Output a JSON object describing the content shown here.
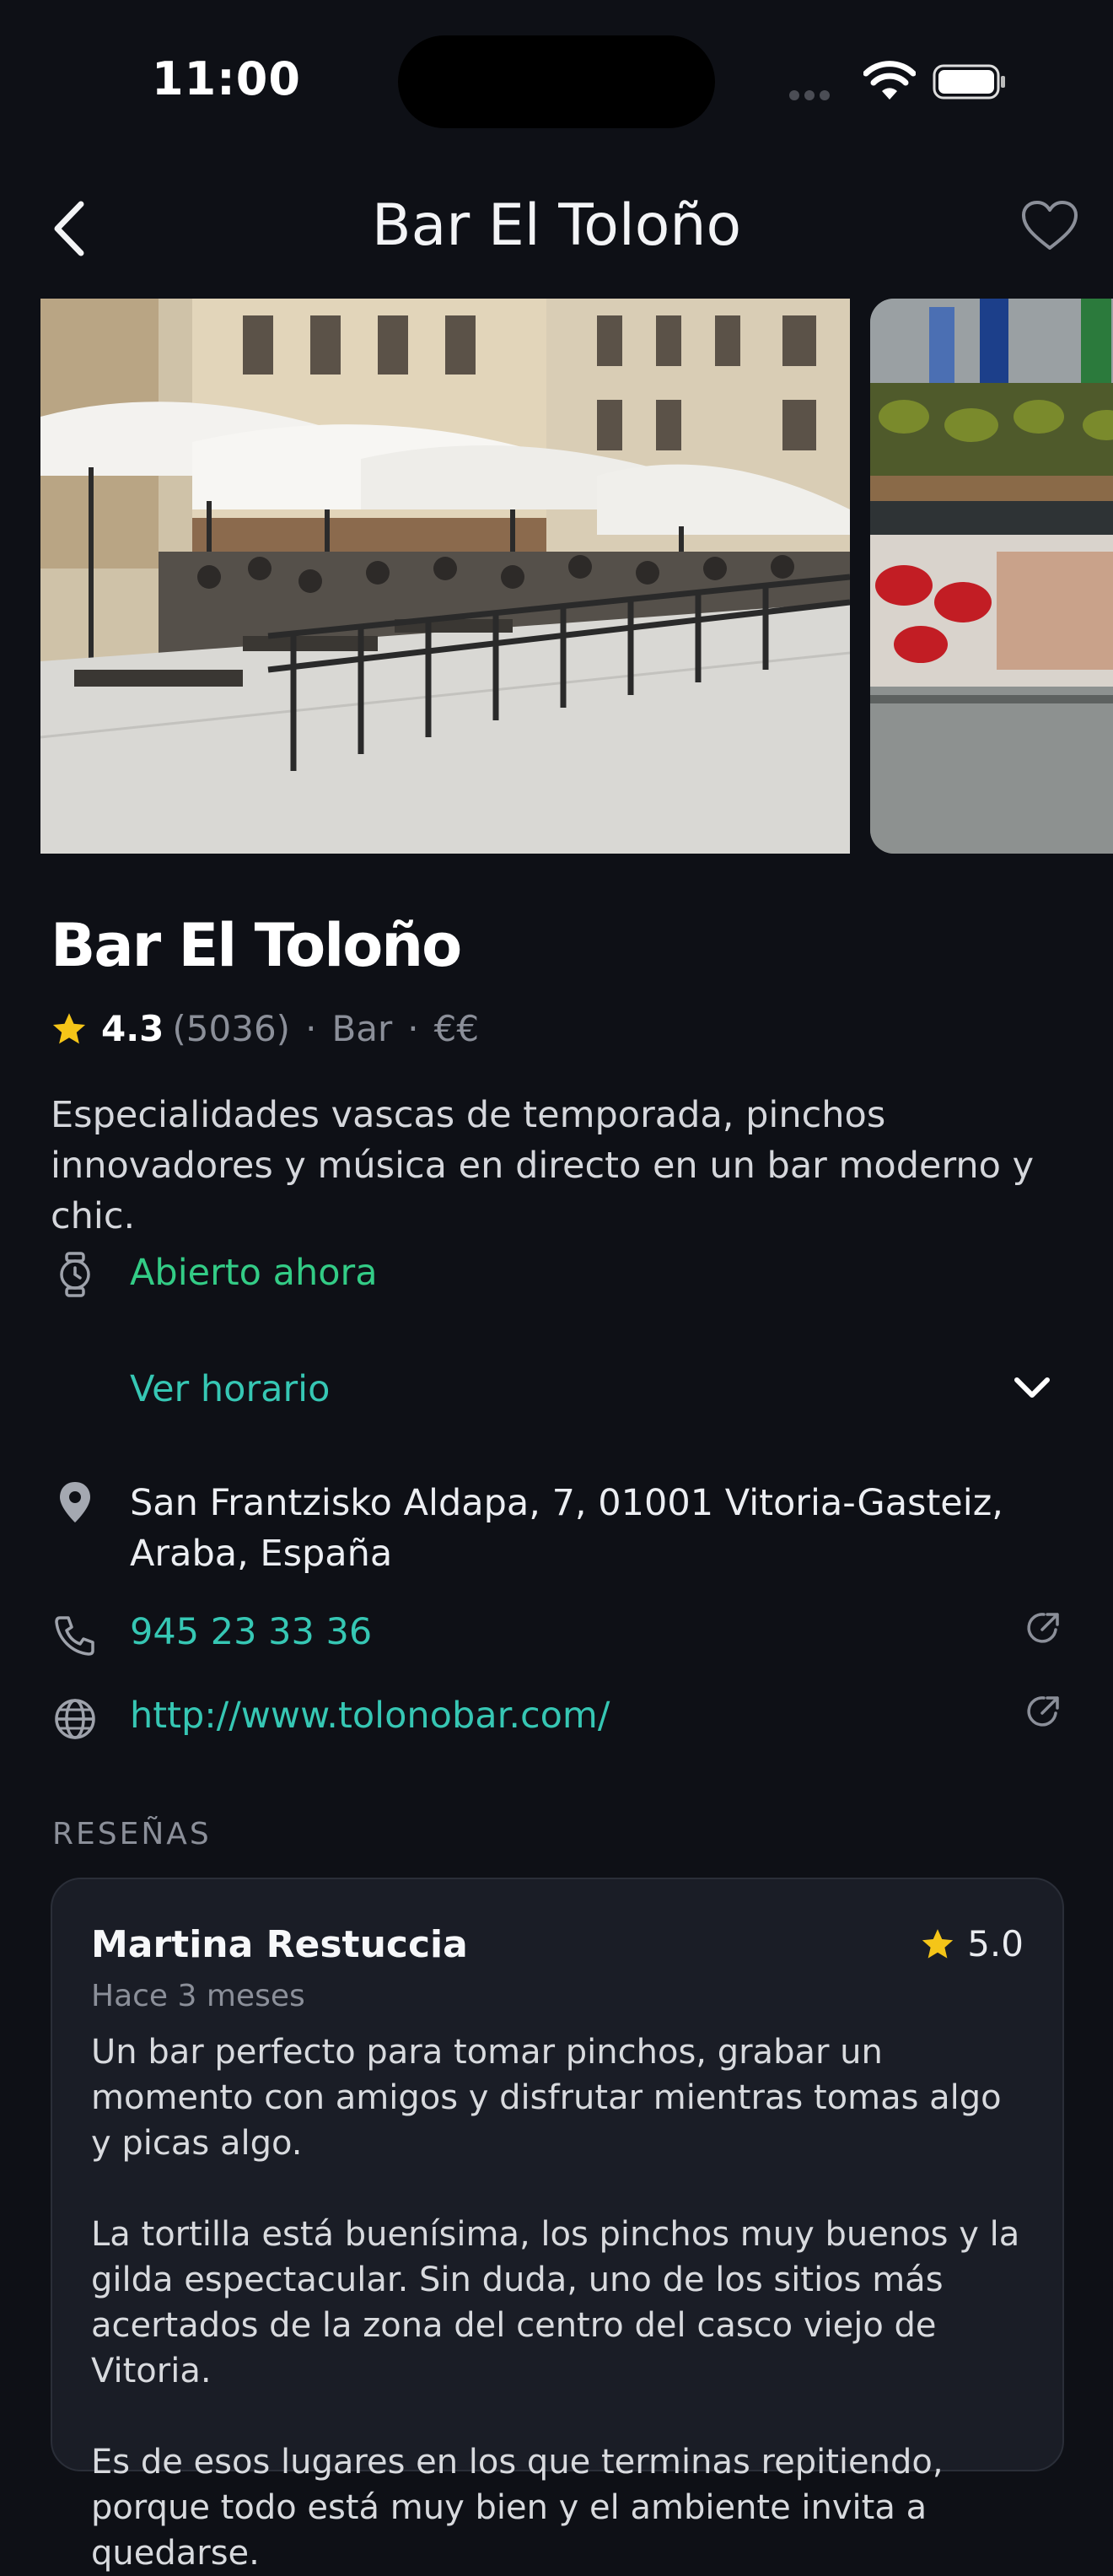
{
  "status_bar": {
    "time": "11:00"
  },
  "nav": {
    "title": "Bar El Toloño"
  },
  "place": {
    "name": "Bar El Toloño",
    "rating": "4.3",
    "reviews_count": "(5036)",
    "separator": "·",
    "category": "Bar",
    "price": "€€",
    "description": "Especialidades vascas de temporada, pinchos innovadores y música en directo en un bar moderno y chic.",
    "open_status": "Abierto ahora",
    "hours_label": "Ver horario",
    "address": "San Frantzisko Aldapa, 7, 01001 Vitoria-Gasteiz, Araba, España",
    "phone": "945 23 33 36",
    "website": "http://www.tolonobar.com/"
  },
  "reviews": {
    "section_title": "RESEÑAS",
    "items": [
      {
        "author": "Martina Restuccia",
        "rating": "5.0",
        "date": "Hace 3 meses",
        "paragraphs": [
          "Un bar perfecto para tomar pinchos, grabar un momento con amigos y disfrutar mientras tomas algo y picas algo.",
          "La tortilla está buenísima, los pinchos muy buenos y la gilda espectacular. Sin duda, uno de los sitios más acertados de la zona del centro del casco viejo de Vitoria.",
          "Es de esos lugares en los que terminas repitiendo, porque todo está muy bien y el ambiente invita a quedarse."
        ]
      }
    ]
  },
  "colors": {
    "background": "#0e1016",
    "open_green": "#33cc86",
    "link_teal": "#36c7b4",
    "star_yellow": "#f5c518",
    "card_bg": "#1a1d26"
  }
}
